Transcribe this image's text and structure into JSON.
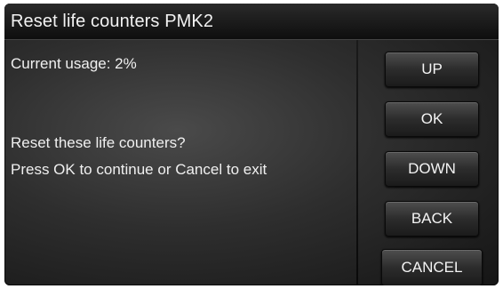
{
  "dialog": {
    "title": "Reset life counters PMK2",
    "usage_text": "Current usage: 2%",
    "question_text": "Reset these life counters?",
    "instruction_text": "Press OK to continue or Cancel to exit"
  },
  "buttons": {
    "up": "UP",
    "ok": "OK",
    "down": "DOWN",
    "back": "BACK",
    "cancel": "CANCEL"
  },
  "colors": {
    "background": "#2e2e2e",
    "text": "#f0f0f0",
    "button_top": "#4e4e4e",
    "button_bottom": "#1b1b1b"
  }
}
